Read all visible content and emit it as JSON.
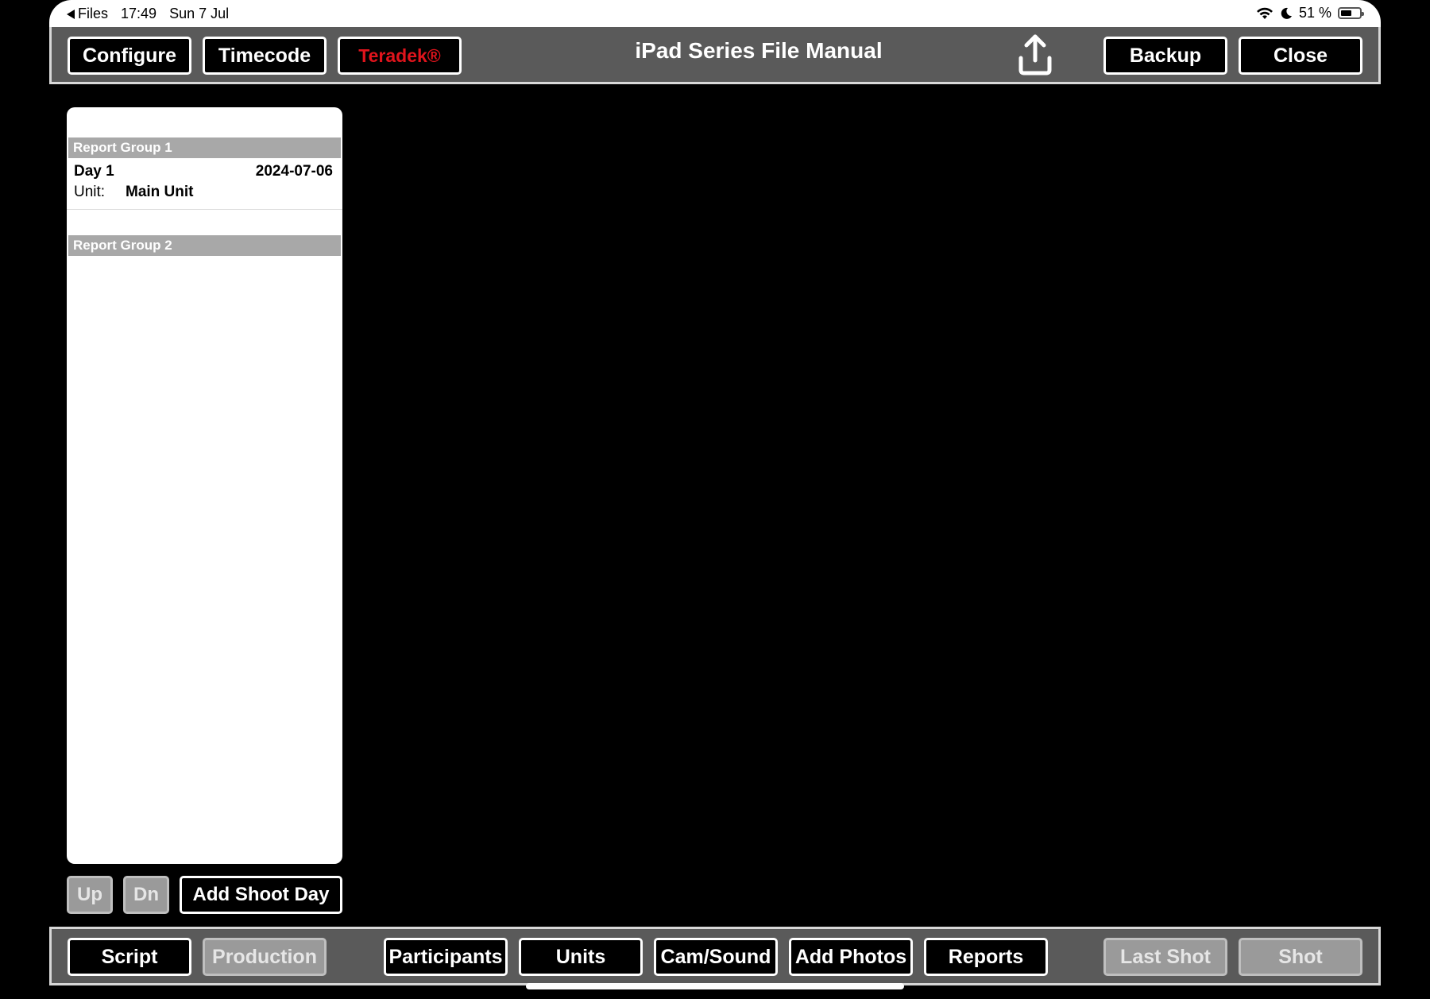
{
  "status_bar": {
    "back_app": "Files",
    "time": "17:49",
    "date": "Sun 7 Jul",
    "battery": "51 %",
    "icons": [
      "back-triangle-icon",
      "wifi-icon",
      "moon-icon",
      "battery-icon"
    ]
  },
  "top_bar": {
    "title": "iPad Series File Manual",
    "configure_label": "Configure",
    "timecode_label": "Timecode",
    "teradek_label": "Teradek®",
    "share_icon": "share-upload-icon",
    "backup_label": "Backup",
    "close_label": "Close"
  },
  "report_list": {
    "groups": [
      {
        "label": "Report Group 1",
        "days": [
          {
            "name": "Day 1",
            "date": "2024-07-06",
            "unit_label": "Unit:",
            "unit_value": "Main Unit"
          }
        ]
      },
      {
        "label": "Report Group 2",
        "days": []
      }
    ]
  },
  "list_controls": {
    "up_label": "Up",
    "dn_label": "Dn",
    "add_shoot_day_label": "Add Shoot Day"
  },
  "bottom_bar": {
    "script_label": "Script",
    "production_label": "Production",
    "participants_label": "Participants",
    "units_label": "Units",
    "cam_sound_label": "Cam/Sound",
    "add_photos_label": "Add Photos",
    "reports_label": "Reports",
    "last_shot_label": "Last Shot",
    "shot_label": "Shot"
  },
  "colors": {
    "toolbar_bg": "#5a5a5a",
    "button_bg": "#000000",
    "accent_red": "#e0141c",
    "disabled_bg": "#9a9a9a",
    "group_header_bg": "#a8a8a8"
  }
}
